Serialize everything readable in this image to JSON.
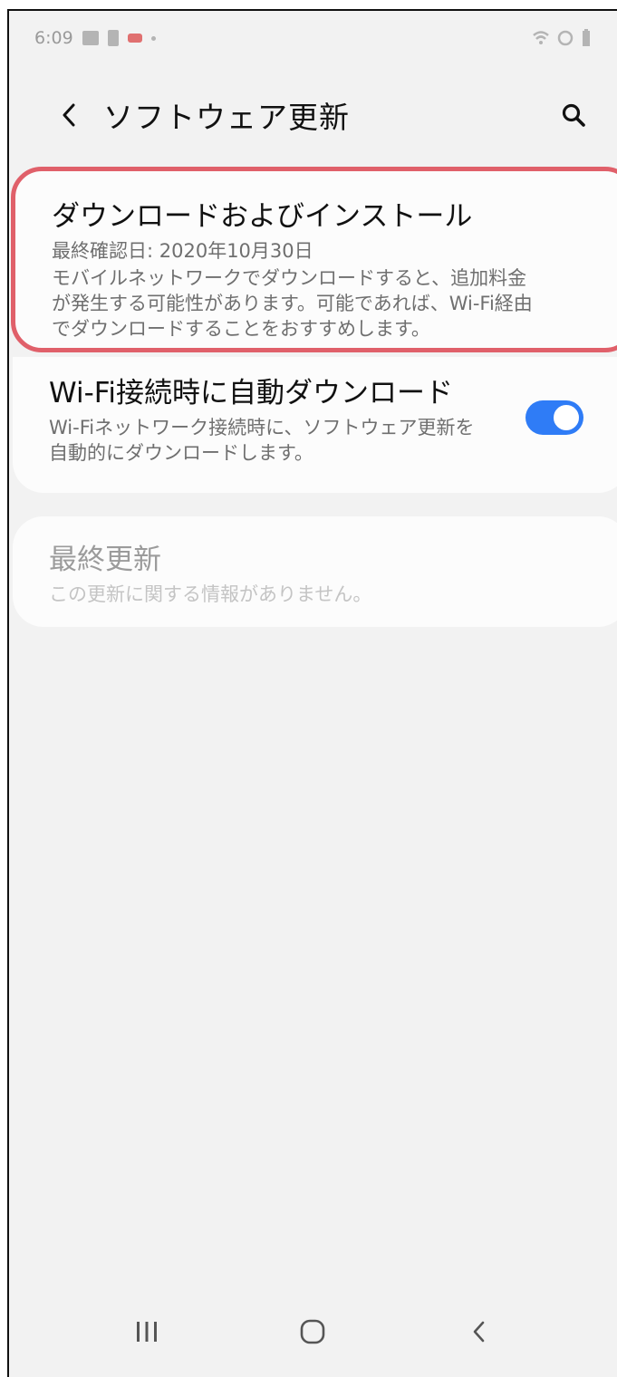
{
  "status_bar": {
    "time": "6:09"
  },
  "app_bar": {
    "title": "ソフトウェア更新"
  },
  "download_card": {
    "title": "ダウンロードおよびインストール",
    "last_checked": "最終確認日: 2020年10月30日",
    "description_line1": "モバイルネットワークでダウンロードすると、追加料金",
    "description_line2": "が発生する可能性があります。可能であれば、Wi-Fi経由",
    "description_line3": "でダウンロードすることをおすすめします。"
  },
  "auto_download": {
    "title": "Wi-Fi接続時に自動ダウンロード",
    "description_line1": "Wi-Fiネットワーク接続時に、ソフトウェア更新を",
    "description_line2": "自動的にダウンロードします。",
    "toggle_on": true,
    "accent_color": "#2f7cf6"
  },
  "last_update": {
    "title": "最終更新",
    "description": "この更新に関する情報がありません。"
  },
  "highlight_color": "#e0606a",
  "icons": {
    "back": "chevron-left-icon",
    "search": "search-icon",
    "recents": "recents-icon",
    "home": "home-icon",
    "nav_back": "nav-back-icon"
  }
}
